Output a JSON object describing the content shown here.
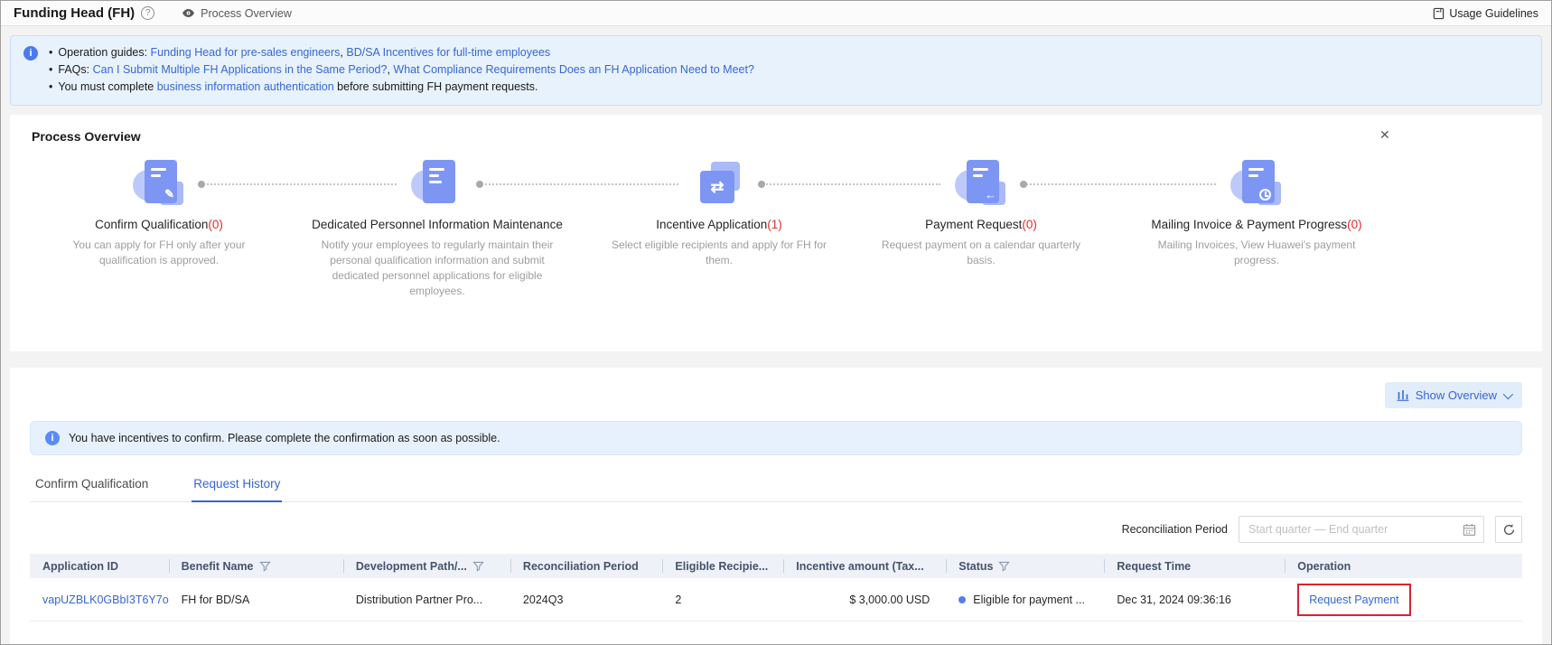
{
  "colors": {
    "accent": "#3567d3",
    "alert_red": "#e02b2b",
    "banner_bg": "#e8f2fd",
    "highlight_box": "#d9232e",
    "status_dot": "#5a7bf0"
  },
  "topbar": {
    "title": "Funding Head (FH)",
    "help_icon": "?",
    "view_label": "Process Overview",
    "usage_guidelines": "Usage Guidelines"
  },
  "notice": {
    "info_glyph": "i",
    "guides_label": "Operation guides: ",
    "guides_link1": "Funding Head for pre-sales engineers",
    "guides_sep": ", ",
    "guides_link2": "BD/SA Incentives for full-time employees",
    "faqs_label": "FAQs: ",
    "faqs_link1": "Can I Submit Multiple FH Applications in the Same Period?",
    "faqs_sep": ", ",
    "faqs_link2": "What Compliance Requirements Does an FH Application Need to Meet?",
    "auth_pre": "You must complete ",
    "auth_link": "business information authentication",
    "auth_post": " before submitting FH payment requests."
  },
  "process": {
    "title": "Process Overview",
    "close_icon": "✕",
    "steps": [
      {
        "title": "Confirm Qualification",
        "count": "(0)",
        "desc": "You can apply for FH only after your qualification is approved."
      },
      {
        "title": "Dedicated Personnel Information Maintenance",
        "count": "",
        "desc": "Notify your employees to regularly maintain their personal qualification information and submit dedicated personnel applications for eligible employees."
      },
      {
        "title": "Incentive Application",
        "count": "(1)",
        "desc": "Select eligible recipients and apply for FH for them."
      },
      {
        "title": "Payment Request",
        "count": "(0)",
        "desc": "Request payment on a calendar quarterly basis."
      },
      {
        "title": "Mailing Invoice & Payment Progress",
        "count": "(0)",
        "desc": "Mailing Invoices, View Huawei's payment progress."
      }
    ]
  },
  "main": {
    "show_overview_label": "Show Overview",
    "incentive_notice": "You have incentives to confirm. Please complete the confirmation as soon as possible.",
    "tabs": [
      {
        "label": "Confirm Qualification"
      },
      {
        "label": "Request History"
      }
    ],
    "filter": {
      "label": "Reconciliation Period",
      "placeholder": "Start quarter — End quarter"
    },
    "table": {
      "columns": [
        {
          "label": "Application ID"
        },
        {
          "label": "Benefit Name"
        },
        {
          "label": "Development Path/..."
        },
        {
          "label": "Reconciliation Period"
        },
        {
          "label": "Eligible Recipie..."
        },
        {
          "label": "Incentive amount (Tax..."
        },
        {
          "label": "Status"
        },
        {
          "label": "Request Time"
        },
        {
          "label": "Operation"
        }
      ],
      "row": {
        "application_id": "vapUZBLK0GBbI3T6Y7o",
        "benefit_name": "FH for BD/SA",
        "development_path": "Distribution Partner Pro...",
        "reconciliation_period": "2024Q3",
        "eligible_recipients": "2",
        "incentive_amount": "$ 3,000.00 USD",
        "status": "Eligible for payment ...",
        "request_time": "Dec 31, 2024 09:36:16",
        "operation_link": "Request Payment"
      }
    }
  }
}
